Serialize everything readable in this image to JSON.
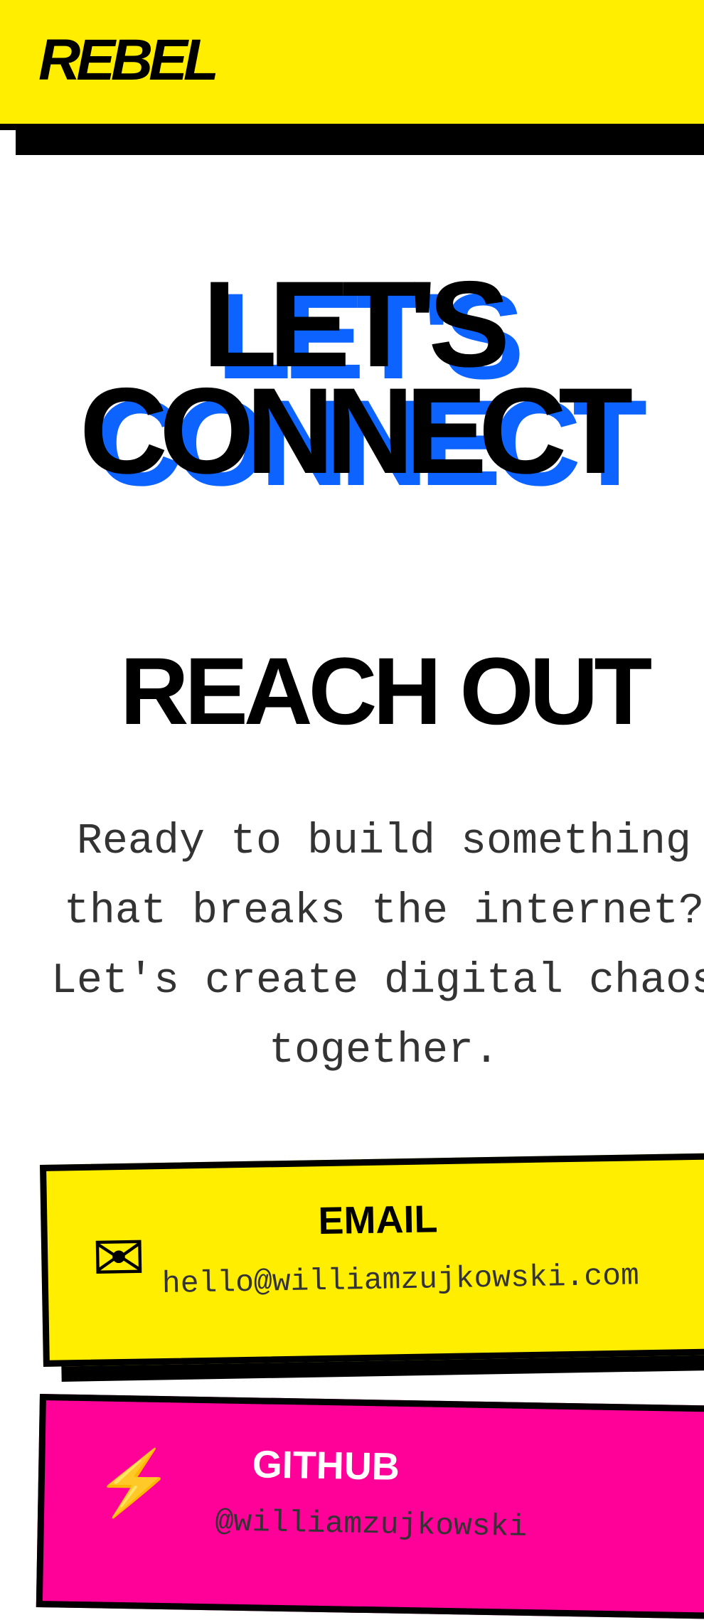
{
  "header": {
    "logo": "REBEL"
  },
  "hero": {
    "line1": "LET'S",
    "line2": "CONNECT"
  },
  "reach_out": {
    "title": "REACH OUT",
    "text": "Ready to build something that breaks the internet? Let's create digital chaos together."
  },
  "cards": {
    "email": {
      "icon": "envelope-icon",
      "glyph": "✉",
      "title": "EMAIL",
      "value": "hello@williamzujkowski.com"
    },
    "github": {
      "icon": "lightning-icon",
      "glyph": "⚡",
      "title": "GITHUB",
      "value": "@williamzujkowski"
    }
  },
  "colors": {
    "yellow": "#ffee00",
    "blue": "#0d63ff",
    "pink": "#ff0099",
    "black": "#000000"
  }
}
